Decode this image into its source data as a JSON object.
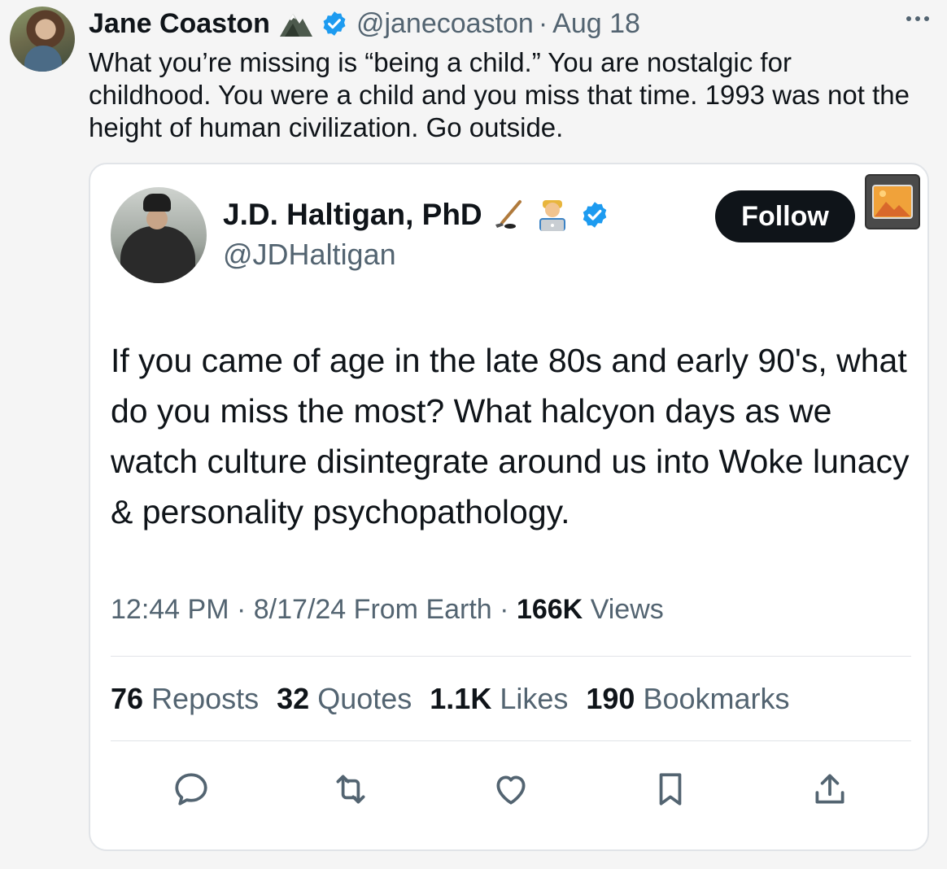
{
  "outer_tweet": {
    "author_name": "Jane Coaston",
    "handle": "@janecoaston",
    "separator": "·",
    "date": "Aug 18",
    "text": "What you’re missing is “being a child.” You are nostalgic for childhood. You were a child and you miss that time. 1993 was not the height of human civilization. Go outside."
  },
  "quoted_tweet": {
    "author_name": "J.D. Haltigan, PhD",
    "handle": "@JDHaltigan",
    "follow_label": "Follow",
    "text": "If you came of age in the late 80s and early 90's, what do you miss the most? What halcyon days as we watch culture disintegrate around us into Woke lunacy & personality psychopathology.",
    "meta": {
      "time": "12:44 PM",
      "sep1": "·",
      "date": "8/17/24",
      "location": "From Earth",
      "sep2": "·",
      "views_count": "166K",
      "views_label": "Views"
    },
    "stats": {
      "reposts_count": "76",
      "reposts_label": "Reposts",
      "quotes_count": "32",
      "quotes_label": "Quotes",
      "likes_count": "1.1K",
      "likes_label": "Likes",
      "bookmarks_count": "190",
      "bookmarks_label": "Bookmarks"
    }
  },
  "icons": [
    "mountain-emoji-icon",
    "verified-badge-icon",
    "more-icon",
    "hockey-stick-emoji-icon",
    "technologist-emoji-icon",
    "image-icon",
    "reply-icon",
    "repost-icon",
    "like-icon",
    "bookmark-icon",
    "share-icon"
  ],
  "colors": {
    "verified_blue": "#1d9bf0",
    "muted_text": "#536471",
    "follow_bg": "#0f1419"
  }
}
